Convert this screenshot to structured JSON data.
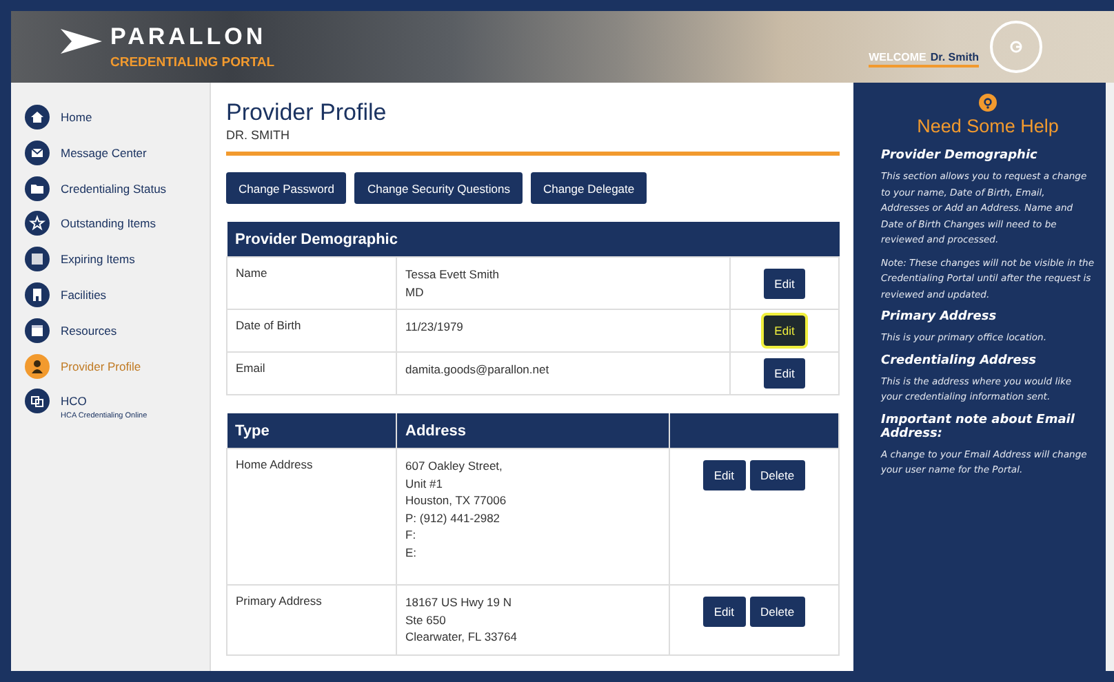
{
  "header": {
    "logo": "PARALLON",
    "subtitle": "CREDENTIALING PORTAL",
    "welcome": "WELCOME",
    "user": "Dr. Smith"
  },
  "sidebar": {
    "items": [
      {
        "label": "Home",
        "selected": false
      },
      {
        "label": "Message Center",
        "selected": false
      },
      {
        "label": "Credentialing Status",
        "selected": false
      },
      {
        "label": "Outstanding Items",
        "selected": false
      },
      {
        "label": "Expiring Items",
        "selected": false
      },
      {
        "label": "Facilities",
        "selected": false
      },
      {
        "label": "Resources",
        "selected": false
      },
      {
        "label": "Provider Profile",
        "selected": true
      },
      {
        "label": "HCO",
        "sublabel": "HCA Credentialing Online",
        "selected": false
      }
    ]
  },
  "page": {
    "title": "Provider Profile",
    "subtitle": "DR. SMITH"
  },
  "actions": [
    "Change Password",
    "Change Security Questions",
    "Change Delegate"
  ],
  "demographic": {
    "title": "Provider Demographic",
    "rows": [
      {
        "label": "Name",
        "value": [
          "Tessa Evett Smith",
          "MD"
        ],
        "button": "Edit",
        "highlighted": false
      },
      {
        "label": "Date of Birth",
        "value": [
          "11/23/1979"
        ],
        "button": "Edit",
        "highlighted": true
      },
      {
        "label": "Email",
        "value": [
          "damita.goods@parallon.net"
        ],
        "button": "Edit",
        "highlighted": false
      }
    ]
  },
  "addresses": {
    "columns": [
      "Type",
      "Address"
    ],
    "rows": [
      {
        "type": "Home Address",
        "lines": [
          "607 Oakley Street,",
          "Unit #1",
          "Houston, TX 77006",
          "P: (912) 441-2982",
          "F:",
          "E:"
        ],
        "buttons": [
          "Edit",
          "Delete"
        ]
      },
      {
        "type": "Primary Address",
        "lines": [
          "18167 US Hwy 19 N",
          "Ste 650",
          "Clearwater, FL 33764"
        ],
        "buttons": [
          "Edit",
          "Delete"
        ]
      }
    ]
  },
  "help": {
    "title": "Need Some Help",
    "sections": [
      {
        "heading": "Provider Demographic",
        "paragraphs": [
          "This section allows you to request a change to your name, Date of Birth, Email, Addresses or Add an Address.  Name and Date of Birth Changes will need to be reviewed and processed.",
          "Note:  These changes will not be visible in the Credentialing Portal until after the request is reviewed and updated."
        ]
      },
      {
        "heading": "Primary Address",
        "paragraphs": [
          "This is your primary office location."
        ]
      },
      {
        "heading": "Credentialing Address",
        "paragraphs": [
          "This is the address where you would like your credentialing information sent."
        ]
      },
      {
        "heading": "Important note about Email Address:",
        "paragraphs": [
          "A change to your Email Address will change your user name for the Portal."
        ]
      }
    ]
  }
}
